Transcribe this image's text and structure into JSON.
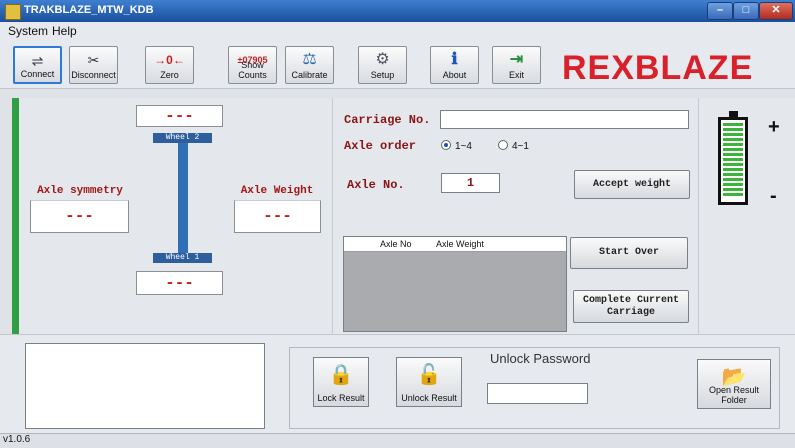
{
  "window": {
    "title": "TRAKBLAZE_MTW_KDB",
    "min_label": "–",
    "max_label": "□",
    "close_label": "✕"
  },
  "menu": {
    "items": [
      "System",
      "Help"
    ]
  },
  "toolbar": {
    "buttons": [
      {
        "label": "Connect",
        "icon": "connect-icon",
        "glyph": "⇌"
      },
      {
        "label": "Disconnect",
        "icon": "disconnect-icon",
        "glyph": "✂"
      },
      {
        "label": "Zero",
        "icon": "zero-icon",
        "glyph": "→0←"
      },
      {
        "label": "Show Counts",
        "icon": "counts-icon",
        "glyph": "±07905"
      },
      {
        "label": "Calibrate",
        "icon": "scale-icon",
        "glyph": "⚖"
      },
      {
        "label": "Setup",
        "icon": "setup-icon",
        "glyph": "⚙"
      },
      {
        "label": "About",
        "icon": "info-icon",
        "glyph": "ℹ"
      },
      {
        "label": "Exit",
        "icon": "exit-icon",
        "glyph": "⇥"
      }
    ]
  },
  "logo": {
    "part1": "REX",
    "part2": "BLAZE"
  },
  "left": {
    "wheel2_value": "---",
    "wheel2_label": "Wheel 2",
    "wheel1_value": "---",
    "wheel1_label": "Wheel 1",
    "axle_symmetry_label": "Axle symmetry",
    "axle_symmetry_value": "---",
    "axle_weight_label": "Axle Weight",
    "axle_weight_value": "---"
  },
  "form": {
    "carriage_label": "Carriage No.",
    "carriage_value": "",
    "axle_order_label": "Axle order",
    "axle_order_options": [
      "1~4",
      "4~1"
    ],
    "axle_no_label": "Axle No.",
    "axle_no_value": "1",
    "accept_weight": "Accept weight",
    "start_over": "Start Over",
    "complete_line1": "Complete Current",
    "complete_line2": "Carriage"
  },
  "table": {
    "columns": [
      "Axle No",
      "Axle Weight"
    ]
  },
  "battery": {
    "plus": "+",
    "minus": "-",
    "level": 1.0,
    "color": "#3cb43c"
  },
  "bottom": {
    "lock_result": "Lock Result",
    "unlock_result": "Unlock Result",
    "unlock_password_label": "Unlock Password",
    "unlock_password_value": "",
    "open_result_line1": "Open Result",
    "open_result_line2": "Folder"
  },
  "status": {
    "version": "v1.0.6"
  }
}
